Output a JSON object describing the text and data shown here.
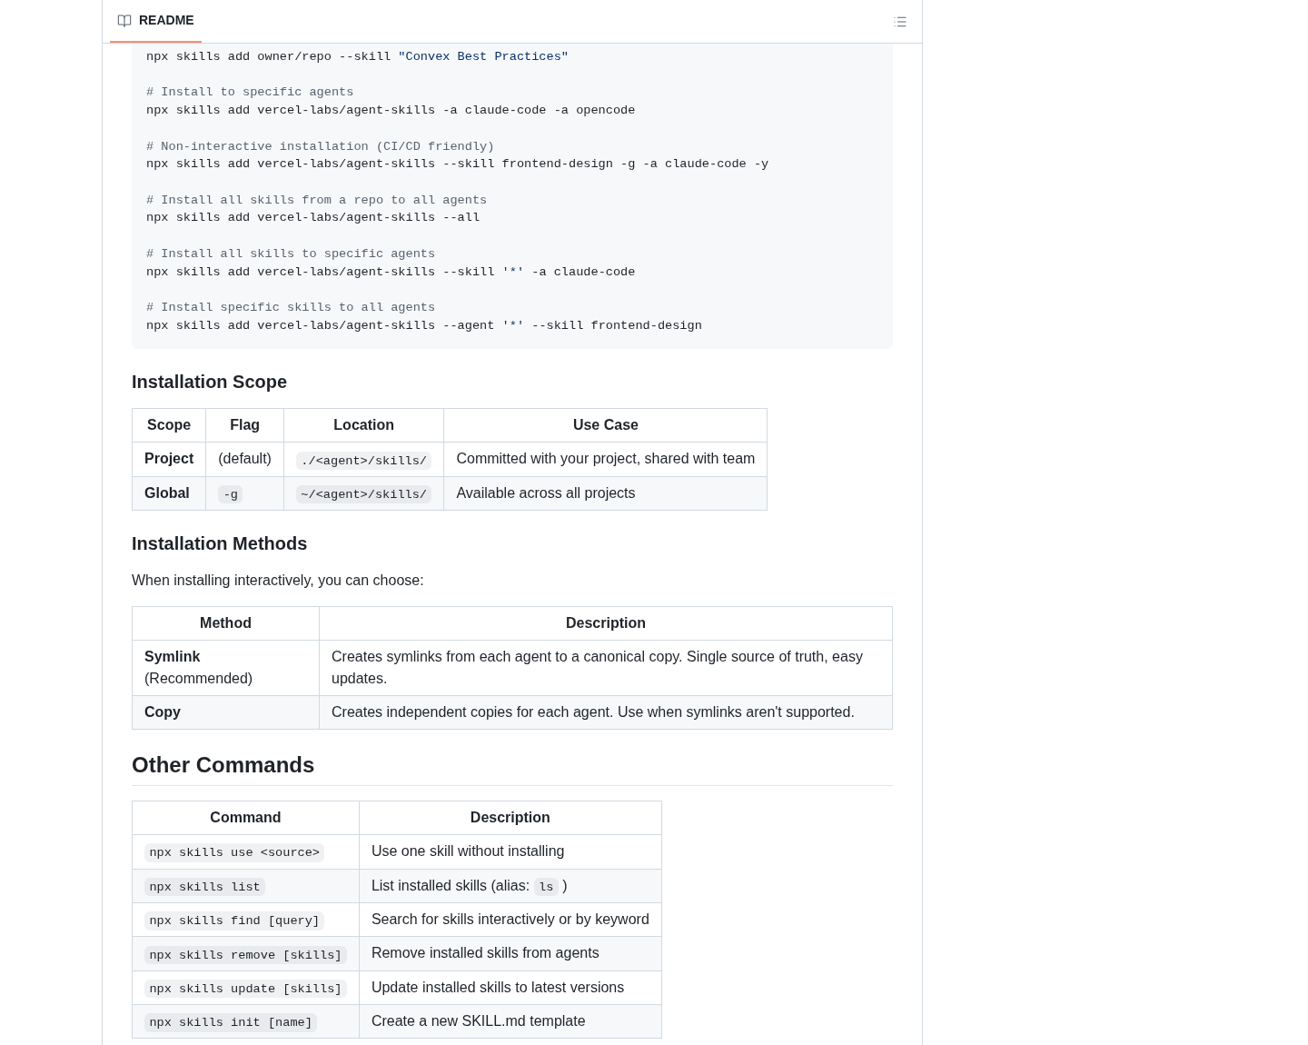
{
  "readme_header": {
    "tabs": [
      {
        "label": "README",
        "selected": true
      }
    ]
  },
  "code_block": {
    "groups": [
      {
        "lines": [
          {
            "tokens": [
              {
                "kind": "plain",
                "text": "npx skills add owner/repo --skill "
              },
              {
                "kind": "string",
                "text": "\"Convex Best Practices\""
              }
            ]
          }
        ]
      },
      {
        "lines": [
          {
            "tokens": [
              {
                "kind": "comment",
                "text": "# Install to specific agents"
              }
            ]
          },
          {
            "tokens": [
              {
                "kind": "plain",
                "text": "npx skills add vercel-labs/agent-skills -a claude-code -a opencode"
              }
            ]
          }
        ]
      },
      {
        "lines": [
          {
            "tokens": [
              {
                "kind": "comment",
                "text": "# Non-interactive installation (CI/CD friendly)"
              }
            ]
          },
          {
            "tokens": [
              {
                "kind": "plain",
                "text": "npx skills add vercel-labs/agent-skills --skill frontend-design -g -a claude-code -y"
              }
            ]
          }
        ]
      },
      {
        "lines": [
          {
            "tokens": [
              {
                "kind": "comment",
                "text": "# Install all skills from a repo to all agents"
              }
            ]
          },
          {
            "tokens": [
              {
                "kind": "plain",
                "text": "npx skills add vercel-labs/agent-skills --all"
              }
            ]
          }
        ]
      },
      {
        "lines": [
          {
            "tokens": [
              {
                "kind": "comment",
                "text": "# Install all skills to specific agents"
              }
            ]
          },
          {
            "tokens": [
              {
                "kind": "plain",
                "text": "npx skills add vercel-labs/agent-skills --skill "
              },
              {
                "kind": "string",
                "text": "'*'"
              },
              {
                "kind": "plain",
                "text": " -a claude-code"
              }
            ]
          }
        ]
      },
      {
        "lines": [
          {
            "tokens": [
              {
                "kind": "comment",
                "text": "# Install specific skills to all agents"
              }
            ]
          },
          {
            "tokens": [
              {
                "kind": "plain",
                "text": "npx skills add vercel-labs/agent-skills --agent "
              },
              {
                "kind": "string",
                "text": "'*'"
              },
              {
                "kind": "plain",
                "text": " --skill frontend-design"
              }
            ]
          }
        ]
      }
    ]
  },
  "content": [
    {
      "kind": "subheading",
      "text": "Installation Scope"
    },
    {
      "kind": "table",
      "columns": [
        "Scope",
        "Flag",
        "Location",
        "Use Case"
      ],
      "rows": [
        [
          [
            {
              "kind": "strong",
              "text": "Project"
            }
          ],
          [
            {
              "kind": "text",
              "text": "(default)"
            }
          ],
          [
            {
              "kind": "code",
              "text": "./<agent>/skills/"
            }
          ],
          [
            {
              "kind": "text",
              "text": "Committed with your project, shared with team"
            }
          ]
        ],
        [
          [
            {
              "kind": "strong",
              "text": "Global"
            }
          ],
          [
            {
              "kind": "code",
              "text": "-g"
            }
          ],
          [
            {
              "kind": "code",
              "text": "~/<agent>/skills/"
            }
          ],
          [
            {
              "kind": "text",
              "text": "Available across all projects"
            }
          ]
        ]
      ]
    },
    {
      "kind": "subheading",
      "text": "Installation Methods"
    },
    {
      "kind": "paragraph",
      "text": "When installing interactively, you can choose:"
    },
    {
      "kind": "table",
      "columns": [
        "Method",
        "Description"
      ],
      "rows": [
        [
          [
            {
              "kind": "strong",
              "text": "Symlink"
            },
            {
              "kind": "text",
              "text": "(Recommended)"
            }
          ],
          [
            {
              "kind": "text",
              "text": "Creates symlinks from each agent to a canonical copy. Single source of truth, easy updates."
            }
          ]
        ],
        [
          [
            {
              "kind": "strong",
              "text": "Copy"
            }
          ],
          [
            {
              "kind": "text",
              "text": "Creates independent copies for each agent. Use when symlinks aren't supported."
            }
          ]
        ]
      ]
    },
    {
      "kind": "heading",
      "text": "Other Commands"
    },
    {
      "kind": "table",
      "columns": [
        "Command",
        "Description"
      ],
      "rows": [
        [
          [
            {
              "kind": "code",
              "text": "npx skills use <source>"
            }
          ],
          [
            {
              "kind": "text",
              "text": "Use one skill without installing"
            }
          ]
        ],
        [
          [
            {
              "kind": "code",
              "text": "npx skills list"
            }
          ],
          [
            {
              "kind": "text",
              "text": "List installed skills (alias:"
            },
            {
              "kind": "code",
              "text": "ls"
            },
            {
              "kind": "text",
              "text": ")"
            }
          ]
        ],
        [
          [
            {
              "kind": "code",
              "text": "npx skills find [query]"
            }
          ],
          [
            {
              "kind": "text",
              "text": "Search for skills interactively or by keyword"
            }
          ]
        ],
        [
          [
            {
              "kind": "code",
              "text": "npx skills remove [skills]"
            }
          ],
          [
            {
              "kind": "text",
              "text": "Remove installed skills from agents"
            }
          ]
        ],
        [
          [
            {
              "kind": "code",
              "text": "npx skills update [skills]"
            }
          ],
          [
            {
              "kind": "text",
              "text": "Update installed skills to latest versions"
            }
          ]
        ],
        [
          [
            {
              "kind": "code",
              "text": "npx skills init [name]"
            }
          ],
          [
            {
              "kind": "text",
              "text": "Create a new SKILL.md template"
            }
          ]
        ]
      ]
    }
  ]
}
